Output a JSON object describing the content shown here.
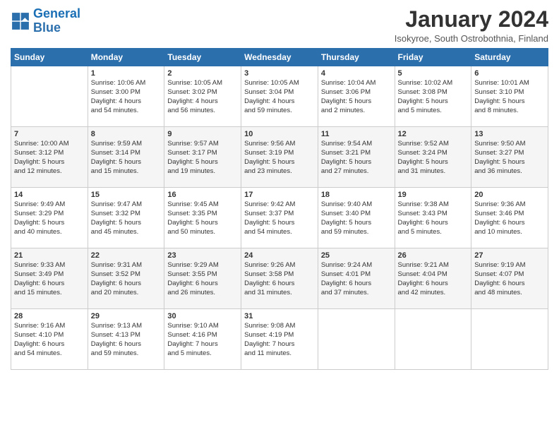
{
  "header": {
    "logo_text_general": "General",
    "logo_text_blue": "Blue",
    "month_title": "January 2024",
    "location": "Isokyroe, South Ostrobothnia, Finland"
  },
  "days_of_week": [
    "Sunday",
    "Monday",
    "Tuesday",
    "Wednesday",
    "Thursday",
    "Friday",
    "Saturday"
  ],
  "weeks": [
    [
      {
        "day": "",
        "text": ""
      },
      {
        "day": "1",
        "text": "Sunrise: 10:06 AM\nSunset: 3:00 PM\nDaylight: 4 hours\nand 54 minutes."
      },
      {
        "day": "2",
        "text": "Sunrise: 10:05 AM\nSunset: 3:02 PM\nDaylight: 4 hours\nand 56 minutes."
      },
      {
        "day": "3",
        "text": "Sunrise: 10:05 AM\nSunset: 3:04 PM\nDaylight: 4 hours\nand 59 minutes."
      },
      {
        "day": "4",
        "text": "Sunrise: 10:04 AM\nSunset: 3:06 PM\nDaylight: 5 hours\nand 2 minutes."
      },
      {
        "day": "5",
        "text": "Sunrise: 10:02 AM\nSunset: 3:08 PM\nDaylight: 5 hours\nand 5 minutes."
      },
      {
        "day": "6",
        "text": "Sunrise: 10:01 AM\nSunset: 3:10 PM\nDaylight: 5 hours\nand 8 minutes."
      }
    ],
    [
      {
        "day": "7",
        "text": "Sunrise: 10:00 AM\nSunset: 3:12 PM\nDaylight: 5 hours\nand 12 minutes."
      },
      {
        "day": "8",
        "text": "Sunrise: 9:59 AM\nSunset: 3:14 PM\nDaylight: 5 hours\nand 15 minutes."
      },
      {
        "day": "9",
        "text": "Sunrise: 9:57 AM\nSunset: 3:17 PM\nDaylight: 5 hours\nand 19 minutes."
      },
      {
        "day": "10",
        "text": "Sunrise: 9:56 AM\nSunset: 3:19 PM\nDaylight: 5 hours\nand 23 minutes."
      },
      {
        "day": "11",
        "text": "Sunrise: 9:54 AM\nSunset: 3:21 PM\nDaylight: 5 hours\nand 27 minutes."
      },
      {
        "day": "12",
        "text": "Sunrise: 9:52 AM\nSunset: 3:24 PM\nDaylight: 5 hours\nand 31 minutes."
      },
      {
        "day": "13",
        "text": "Sunrise: 9:50 AM\nSunset: 3:27 PM\nDaylight: 5 hours\nand 36 minutes."
      }
    ],
    [
      {
        "day": "14",
        "text": "Sunrise: 9:49 AM\nSunset: 3:29 PM\nDaylight: 5 hours\nand 40 minutes."
      },
      {
        "day": "15",
        "text": "Sunrise: 9:47 AM\nSunset: 3:32 PM\nDaylight: 5 hours\nand 45 minutes."
      },
      {
        "day": "16",
        "text": "Sunrise: 9:45 AM\nSunset: 3:35 PM\nDaylight: 5 hours\nand 50 minutes."
      },
      {
        "day": "17",
        "text": "Sunrise: 9:42 AM\nSunset: 3:37 PM\nDaylight: 5 hours\nand 54 minutes."
      },
      {
        "day": "18",
        "text": "Sunrise: 9:40 AM\nSunset: 3:40 PM\nDaylight: 5 hours\nand 59 minutes."
      },
      {
        "day": "19",
        "text": "Sunrise: 9:38 AM\nSunset: 3:43 PM\nDaylight: 6 hours\nand 5 minutes."
      },
      {
        "day": "20",
        "text": "Sunrise: 9:36 AM\nSunset: 3:46 PM\nDaylight: 6 hours\nand 10 minutes."
      }
    ],
    [
      {
        "day": "21",
        "text": "Sunrise: 9:33 AM\nSunset: 3:49 PM\nDaylight: 6 hours\nand 15 minutes."
      },
      {
        "day": "22",
        "text": "Sunrise: 9:31 AM\nSunset: 3:52 PM\nDaylight: 6 hours\nand 20 minutes."
      },
      {
        "day": "23",
        "text": "Sunrise: 9:29 AM\nSunset: 3:55 PM\nDaylight: 6 hours\nand 26 minutes."
      },
      {
        "day": "24",
        "text": "Sunrise: 9:26 AM\nSunset: 3:58 PM\nDaylight: 6 hours\nand 31 minutes."
      },
      {
        "day": "25",
        "text": "Sunrise: 9:24 AM\nSunset: 4:01 PM\nDaylight: 6 hours\nand 37 minutes."
      },
      {
        "day": "26",
        "text": "Sunrise: 9:21 AM\nSunset: 4:04 PM\nDaylight: 6 hours\nand 42 minutes."
      },
      {
        "day": "27",
        "text": "Sunrise: 9:19 AM\nSunset: 4:07 PM\nDaylight: 6 hours\nand 48 minutes."
      }
    ],
    [
      {
        "day": "28",
        "text": "Sunrise: 9:16 AM\nSunset: 4:10 PM\nDaylight: 6 hours\nand 54 minutes."
      },
      {
        "day": "29",
        "text": "Sunrise: 9:13 AM\nSunset: 4:13 PM\nDaylight: 6 hours\nand 59 minutes."
      },
      {
        "day": "30",
        "text": "Sunrise: 9:10 AM\nSunset: 4:16 PM\nDaylight: 7 hours\nand 5 minutes."
      },
      {
        "day": "31",
        "text": "Sunrise: 9:08 AM\nSunset: 4:19 PM\nDaylight: 7 hours\nand 11 minutes."
      },
      {
        "day": "",
        "text": ""
      },
      {
        "day": "",
        "text": ""
      },
      {
        "day": "",
        "text": ""
      }
    ]
  ]
}
